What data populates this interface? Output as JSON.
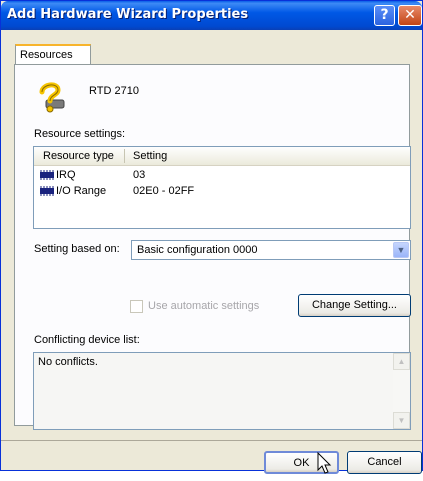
{
  "window": {
    "title": "Add Hardware Wizard Properties"
  },
  "tabs": [
    {
      "label": "Resources"
    }
  ],
  "device": {
    "name": "RTD 2710"
  },
  "resource_settings": {
    "label": "Resource settings:",
    "columns": [
      "Resource type",
      "Setting"
    ],
    "rows": [
      {
        "type": "IRQ",
        "setting": "03"
      },
      {
        "type": "I/O Range",
        "setting": "02E0 - 02FF"
      }
    ]
  },
  "setting_based_on": {
    "label": "Setting based on:",
    "value": "Basic configuration 0000"
  },
  "use_automatic_settings": {
    "label": "Use automatic settings",
    "checked": false,
    "enabled": false
  },
  "change_setting_button": "Change Setting...",
  "conflicting": {
    "label": "Conflicting device list:",
    "text": "No conflicts."
  },
  "buttons": {
    "ok": "OK",
    "cancel": "Cancel"
  },
  "icons": {
    "help": "help-icon",
    "close": "close-icon",
    "device": "question-device-icon",
    "resource": "resource-chip-icon",
    "dropdown": "chevron-down-icon",
    "cursor": "mouse-pointer-icon"
  },
  "colors": {
    "title_bar": "#0058e6",
    "tab_highlight": "#f7b42c",
    "close_button": "#c24515"
  }
}
